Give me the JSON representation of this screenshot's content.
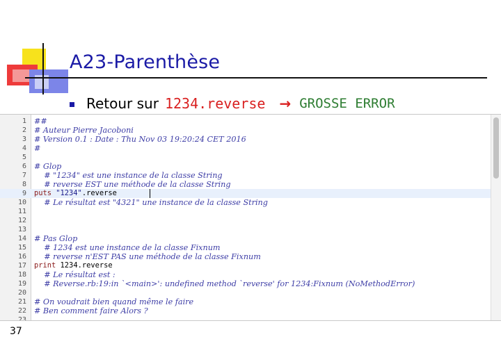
{
  "slide": {
    "title": "A23-Parenthèse",
    "bullet_text": "Retour sur",
    "bullet_code": "1234.reverse",
    "bullet_arrow": "→",
    "bullet_result": "GROSSE ERROR",
    "page_number": "37"
  },
  "colors": {
    "title": "#1a1aa6",
    "accent_red": "#d92020",
    "accent_green": "#2e7d32",
    "comment": "#3d3da6",
    "current_line": "#e8f0fc"
  },
  "editor": {
    "current_line": 9,
    "lines": [
      {
        "n": "1",
        "segments": [
          {
            "t": "##",
            "k": "comment"
          }
        ]
      },
      {
        "n": "2",
        "segments": [
          {
            "t": "# Auteur Pierre Jacoboni",
            "k": "comment"
          }
        ]
      },
      {
        "n": "3",
        "segments": [
          {
            "t": "# Version 0.1 : Date : Thu Nov 03 19:20:24 CET 2016",
            "k": "comment"
          }
        ]
      },
      {
        "n": "4",
        "segments": [
          {
            "t": "#",
            "k": "comment"
          }
        ]
      },
      {
        "n": "5",
        "segments": []
      },
      {
        "n": "6",
        "segments": [
          {
            "t": "# Glop",
            "k": "comment"
          }
        ]
      },
      {
        "n": "7",
        "segments": [
          {
            "t": "    # \"1234\" est une instance de la classe String",
            "k": "comment"
          }
        ]
      },
      {
        "n": "8",
        "segments": [
          {
            "t": "    # reverse EST une méthode de la classe String",
            "k": "comment"
          }
        ]
      },
      {
        "n": "9",
        "segments": [
          {
            "t": "puts ",
            "k": "kw"
          },
          {
            "t": "\"1234\"",
            "k": "str"
          },
          {
            "t": ".reverse",
            "k": "plain"
          }
        ]
      },
      {
        "n": "10",
        "segments": [
          {
            "t": "    # Le résultat est \"4321\" une instance de la classe String",
            "k": "comment"
          }
        ]
      },
      {
        "n": "11",
        "segments": []
      },
      {
        "n": "12",
        "segments": []
      },
      {
        "n": "13",
        "segments": []
      },
      {
        "n": "14",
        "segments": [
          {
            "t": "# Pas Glop",
            "k": "comment"
          }
        ]
      },
      {
        "n": "15",
        "segments": [
          {
            "t": "    # 1234 est une instance de la classe Fixnum",
            "k": "comment"
          }
        ]
      },
      {
        "n": "16",
        "segments": [
          {
            "t": "    # reverse n'EST PAS une méthode de la classe Fixnum",
            "k": "comment"
          }
        ]
      },
      {
        "n": "17",
        "segments": [
          {
            "t": "print ",
            "k": "kw"
          },
          {
            "t": "1234.reverse",
            "k": "plain"
          }
        ]
      },
      {
        "n": "18",
        "segments": [
          {
            "t": "    # Le résultat est :",
            "k": "comment"
          }
        ]
      },
      {
        "n": "19",
        "segments": [
          {
            "t": "    # Reverse.rb:19:in `<main>': undefined method `reverse' for 1234:Fixnum (NoMethodError)",
            "k": "comment"
          }
        ]
      },
      {
        "n": "20",
        "segments": []
      },
      {
        "n": "21",
        "segments": [
          {
            "t": "# On voudrait bien quand même le faire",
            "k": "comment"
          }
        ]
      },
      {
        "n": "22",
        "segments": [
          {
            "t": "# Ben comment faire Alors ?",
            "k": "comment"
          }
        ]
      },
      {
        "n": "23",
        "segments": []
      }
    ]
  }
}
